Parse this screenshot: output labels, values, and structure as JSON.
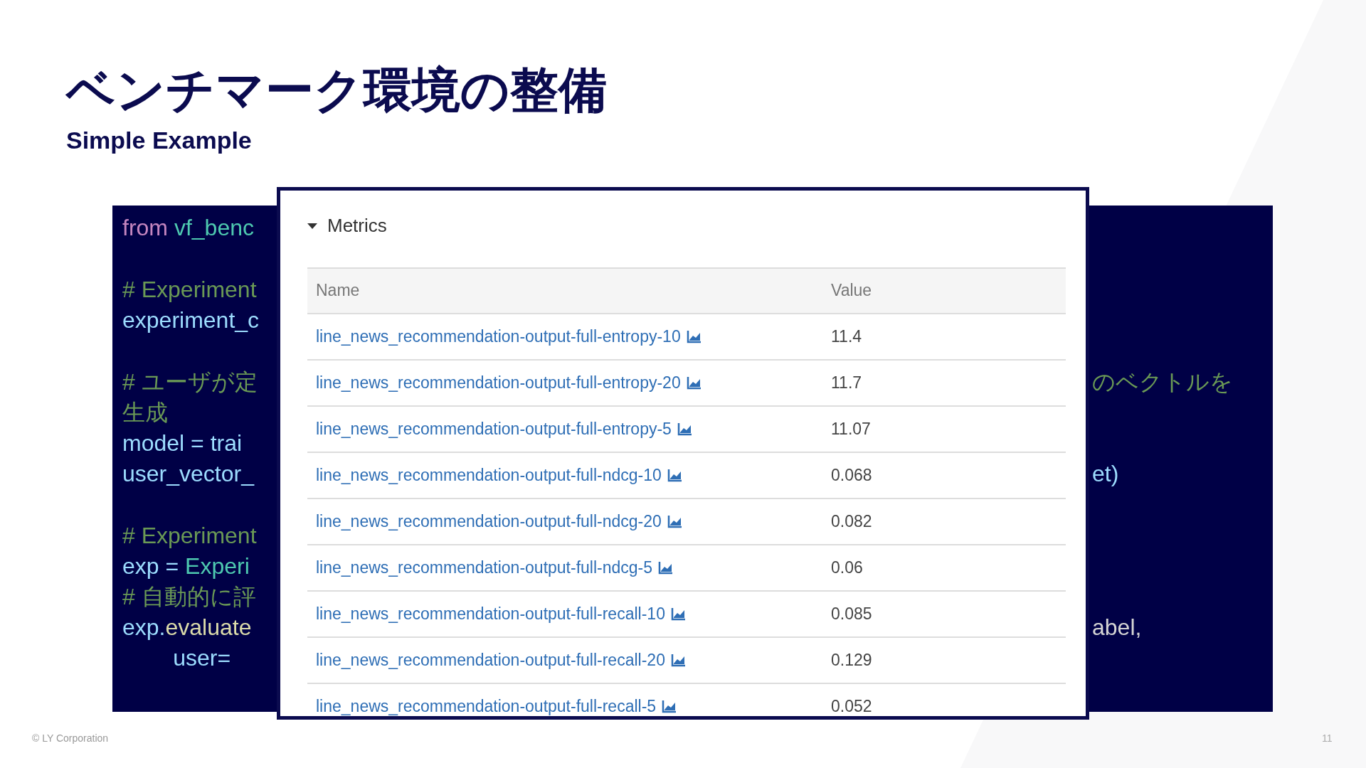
{
  "slide": {
    "title": "ベンチマーク環境の整備",
    "subtitle": "Simple Example",
    "footer": "© LY Corporation",
    "page_number": "11"
  },
  "code_lines": [
    {
      "kind": "code",
      "left": [
        {
          "text": "from",
          "kind": "keyword"
        },
        {
          "text": " vf_benc",
          "kind": "module"
        }
      ]
    },
    {
      "kind": "gap"
    },
    {
      "kind": "code",
      "left": [
        {
          "text": "# Experiment",
          "kind": "comment"
        }
      ]
    },
    {
      "kind": "code",
      "left": [
        {
          "text": "experiment_c",
          "kind": "variable"
        }
      ]
    },
    {
      "kind": "gap"
    },
    {
      "kind": "code",
      "left": [
        {
          "text": "# ユーザが定",
          "kind": "comment"
        }
      ],
      "right": {
        "text": "のベクトルを",
        "kind": "comment"
      }
    },
    {
      "kind": "code",
      "left": [
        {
          "text": "生成",
          "kind": "comment"
        }
      ]
    },
    {
      "kind": "code",
      "left": [
        {
          "text": "model = trai",
          "kind": "variable"
        }
      ]
    },
    {
      "kind": "code",
      "left": [
        {
          "text": "user_vector_",
          "kind": "variable"
        }
      ],
      "right": {
        "text": "et)",
        "kind": "variable"
      }
    },
    {
      "kind": "gap"
    },
    {
      "kind": "code",
      "left": [
        {
          "text": "# Experiment",
          "kind": "comment"
        }
      ]
    },
    {
      "kind": "code",
      "left": [
        {
          "text": "exp = ",
          "kind": "variable"
        },
        {
          "text": "Experi",
          "kind": "module"
        }
      ]
    },
    {
      "kind": "code",
      "left": [
        {
          "text": "# 自動的に評",
          "kind": "comment"
        }
      ]
    },
    {
      "kind": "code",
      "left": [
        {
          "text": "exp.",
          "kind": "variable"
        },
        {
          "text": "evaluate",
          "kind": "function"
        }
      ],
      "right": {
        "text": "abel,",
        "kind": "plain"
      }
    },
    {
      "kind": "code",
      "left": [
        {
          "text": "        user=",
          "kind": "variable"
        }
      ]
    }
  ],
  "metrics": {
    "title": "Metrics",
    "expanded": true,
    "columns": [
      "Name",
      "Value"
    ],
    "rows": [
      {
        "name": "line_news_recommendation-output-full-entropy-10",
        "value": "11.4"
      },
      {
        "name": "line_news_recommendation-output-full-entropy-20",
        "value": "11.7"
      },
      {
        "name": "line_news_recommendation-output-full-entropy-5",
        "value": "11.07"
      },
      {
        "name": "line_news_recommendation-output-full-ndcg-10",
        "value": "0.068"
      },
      {
        "name": "line_news_recommendation-output-full-ndcg-20",
        "value": "0.082"
      },
      {
        "name": "line_news_recommendation-output-full-ndcg-5",
        "value": "0.06"
      },
      {
        "name": "line_news_recommendation-output-full-recall-10",
        "value": "0.085"
      },
      {
        "name": "line_news_recommendation-output-full-recall-20",
        "value": "0.129"
      },
      {
        "name": "line_news_recommendation-output-full-recall-5",
        "value": "0.052"
      }
    ]
  }
}
